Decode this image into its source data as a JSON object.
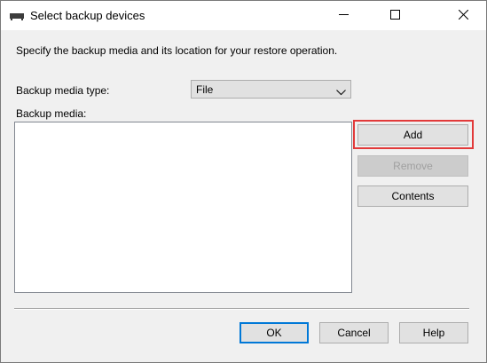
{
  "window": {
    "title": "Select backup devices",
    "icon": "backup-device-icon"
  },
  "titlebar_controls": {
    "minimize_icon": "minimize-icon",
    "maximize_icon": "maximize-icon",
    "close_icon": "close-icon"
  },
  "description": "Specify the backup media and its location for your restore operation.",
  "media_type": {
    "label": "Backup media type:",
    "selected": "File"
  },
  "backup_media": {
    "label": "Backup media:",
    "items": []
  },
  "side_buttons": {
    "add": "Add",
    "remove": "Remove",
    "contents": "Contents"
  },
  "footer_buttons": {
    "ok": "OK",
    "cancel": "Cancel",
    "help": "Help"
  },
  "colors": {
    "highlight": "#e23a3a",
    "default_button_border": "#0078d7"
  }
}
